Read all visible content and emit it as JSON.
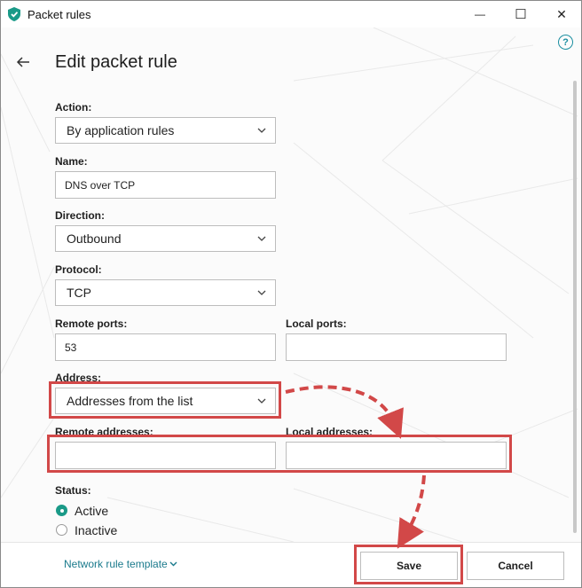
{
  "window": {
    "title": "Packet rules",
    "minimize_glyph": "—",
    "maximize_glyph": "☐",
    "close_glyph": "✕",
    "help_glyph": "?"
  },
  "page": {
    "heading": "Edit packet rule"
  },
  "form": {
    "action": {
      "label": "Action:",
      "value": "By application rules"
    },
    "name": {
      "label": "Name:",
      "value": "DNS over TCP"
    },
    "direction": {
      "label": "Direction:",
      "value": "Outbound"
    },
    "protocol": {
      "label": "Protocol:",
      "value": "TCP"
    },
    "remote_ports": {
      "label": "Remote ports:",
      "value": "53"
    },
    "local_ports": {
      "label": "Local ports:",
      "value": ""
    },
    "address": {
      "label": "Address:",
      "value": "Addresses from the list"
    },
    "remote_addresses": {
      "label": "Remote addresses:",
      "value": ""
    },
    "local_addresses": {
      "label": "Local addresses:",
      "value": ""
    },
    "status": {
      "label": "Status:",
      "options": [
        "Active",
        "Inactive"
      ],
      "selected": "Active"
    }
  },
  "footer": {
    "template_link": "Network rule template",
    "save_label": "Save",
    "cancel_label": "Cancel"
  },
  "colors": {
    "accent": "#1a9a88",
    "link": "#1a7a8c",
    "highlight": "#d24848"
  }
}
